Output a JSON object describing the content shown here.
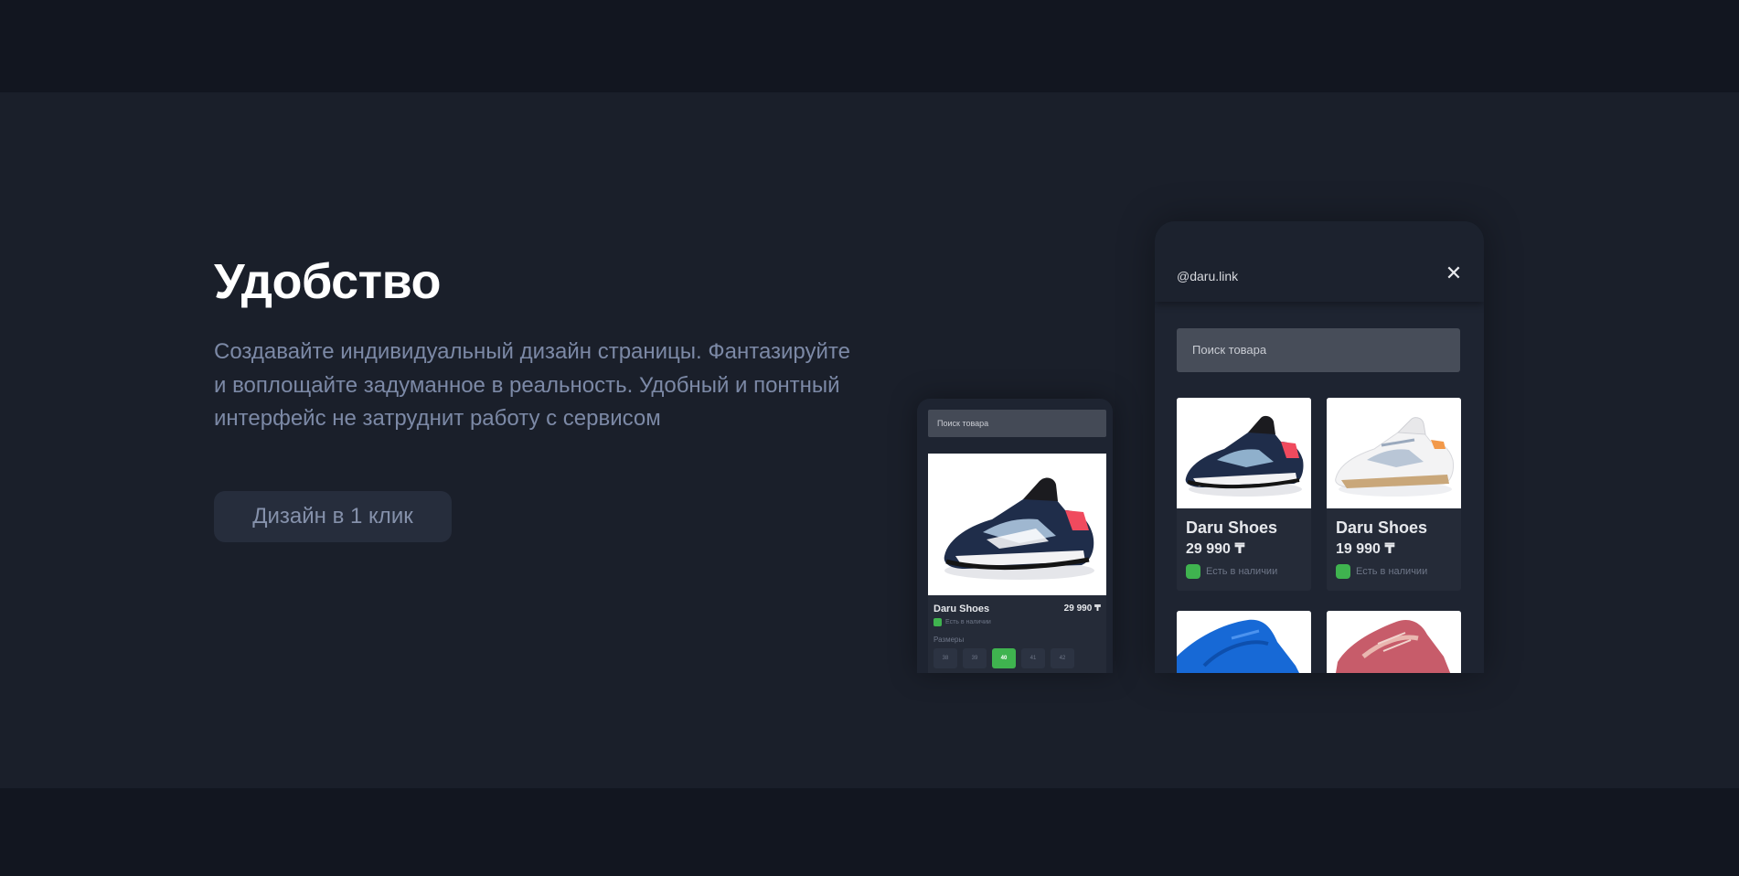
{
  "section": {
    "heading": "Удобство",
    "description_lines": [
      "Создавайте индивидуальный дизайн страницы. Фантазируйте",
      "и воплощайте задуманное в реальность. Удобный и понтный",
      "интерфейс не затруднит работу с сервисом"
    ],
    "cta_label": "Дизайн в 1 клик"
  },
  "phone_small": {
    "search_placeholder": "Поиск товара",
    "product_name": "Daru Shoes",
    "product_price": "29 990 ₸",
    "stock_text": "Есть в наличии",
    "sizes_label": "Размеры",
    "sizes": [
      "38",
      "39",
      "40",
      "41",
      "42"
    ],
    "active_size": "40"
  },
  "phone_big": {
    "handle": "@daru.link",
    "search_placeholder": "Поиск товара",
    "products": [
      {
        "name": "Daru Shoes",
        "price": "29 990 ₸",
        "stock": "Есть в наличии"
      },
      {
        "name": "Daru Shoes",
        "price": "19 990 ₸",
        "stock": "Есть в наличии"
      }
    ]
  },
  "colors": {
    "background_outer": "#121620",
    "background_section": "#1a1f2a",
    "accent_green": "#3fb34f",
    "text_muted": "#7c89a6"
  }
}
